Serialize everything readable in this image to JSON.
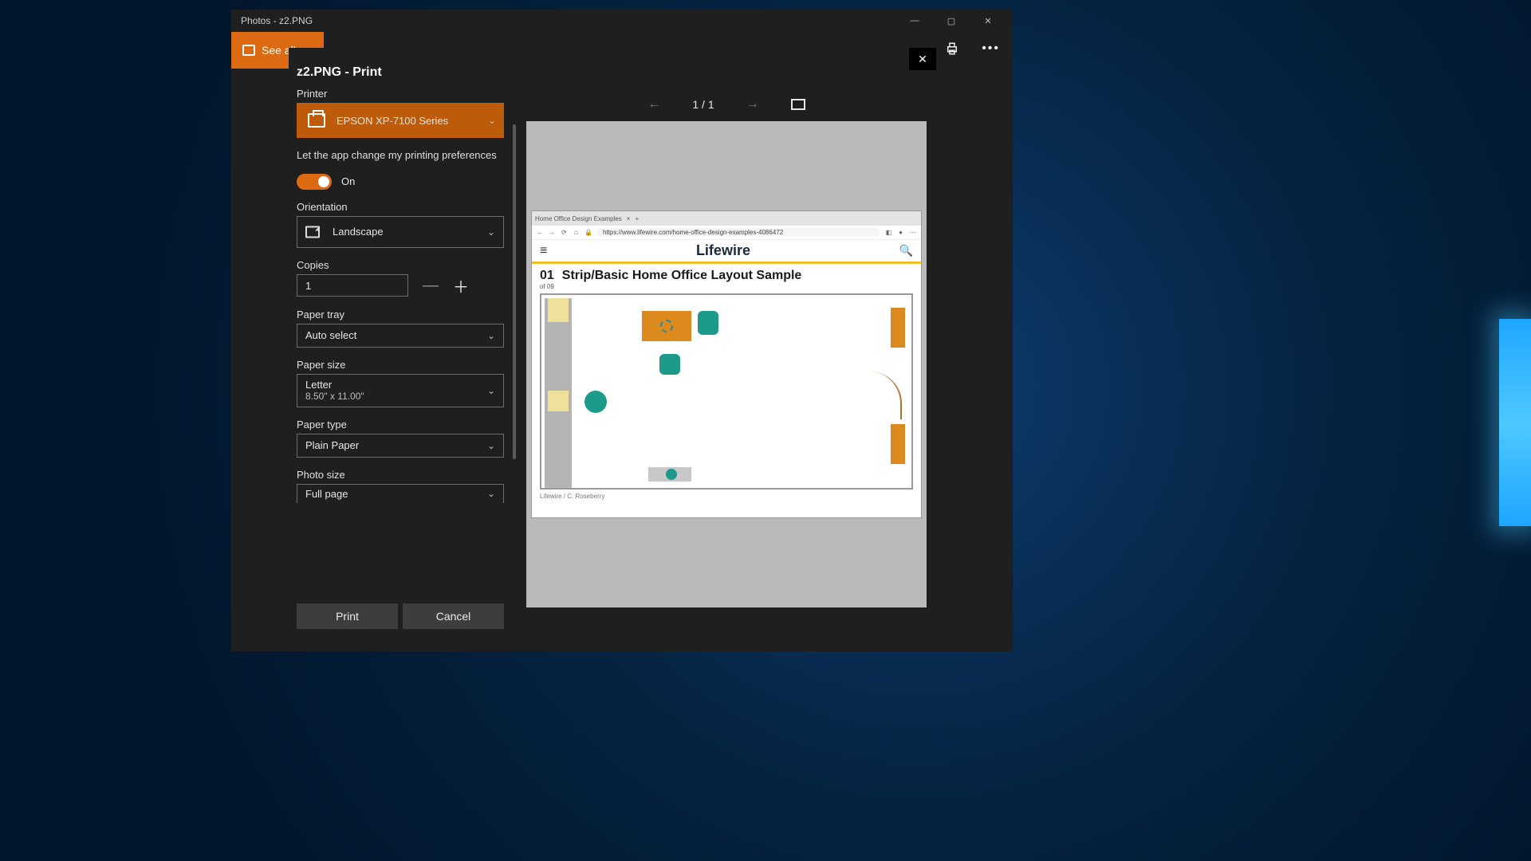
{
  "window": {
    "title": "Photos - z2.PNG"
  },
  "toolbar": {
    "see_all": "See all"
  },
  "print": {
    "title": "z2.PNG - Print",
    "printer_label": "Printer",
    "printer_value": "EPSON XP-7100 Series",
    "pref_text": "Let the app change my printing preferences",
    "toggle_state": "On",
    "orientation_label": "Orientation",
    "orientation_value": "Landscape",
    "copies_label": "Copies",
    "copies_value": "1",
    "tray_label": "Paper tray",
    "tray_value": "Auto select",
    "size_label": "Paper size",
    "size_value": "Letter",
    "size_sub": "8.50\" x 11.00\"",
    "type_label": "Paper type",
    "type_value": "Plain Paper",
    "photosize_label": "Photo size",
    "photosize_value": "Full page",
    "print_btn": "Print",
    "cancel_btn": "Cancel"
  },
  "preview": {
    "pager": "1 / 1",
    "tab": "Home Office Design Examples",
    "url": "https://www.lifewire.com/home-office-design-examples-4086472",
    "brand": "Lifewire",
    "article_number": "01",
    "article_title": "Strip/Basic Home Office Layout Sample",
    "article_sub": "of 09",
    "credit": "Lifewire / C. Roseberry"
  }
}
